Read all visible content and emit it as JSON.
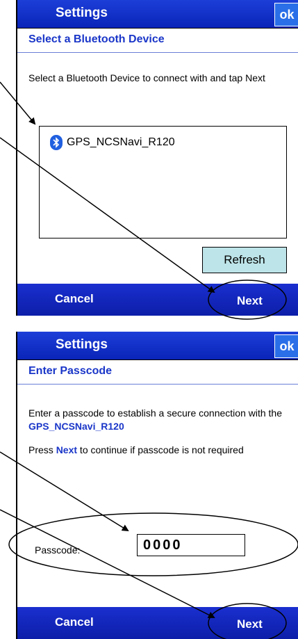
{
  "screen1": {
    "title": "Settings",
    "ok_label": "ok",
    "subheader": "Select a Bluetooth Device",
    "instruction": "Select a Bluetooth Device to connect with and tap Next",
    "devices": [
      {
        "name": "GPS_NCSNavi_R120",
        "icon": "bluetooth-icon"
      }
    ],
    "refresh_label": "Refresh",
    "cancel_label": "Cancel",
    "next_label": "Next"
  },
  "screen2": {
    "title": "Settings",
    "ok_label": "ok",
    "subheader": "Enter Passcode",
    "instruction_prefix": "Enter a passcode to establish a secure connection with the ",
    "instruction_device": "GPS_NCSNavi_R120",
    "press_prefix": "Press ",
    "press_next": "Next",
    "press_suffix": " to continue if passcode is not required",
    "passcode_label": "Passcode:",
    "passcode_value": "0000",
    "cancel_label": "Cancel",
    "next_label": "Next"
  },
  "colors": {
    "titlebar": "#0a24b8",
    "accent_text": "#1a36c8",
    "refresh_bg": "#bde4e8"
  }
}
